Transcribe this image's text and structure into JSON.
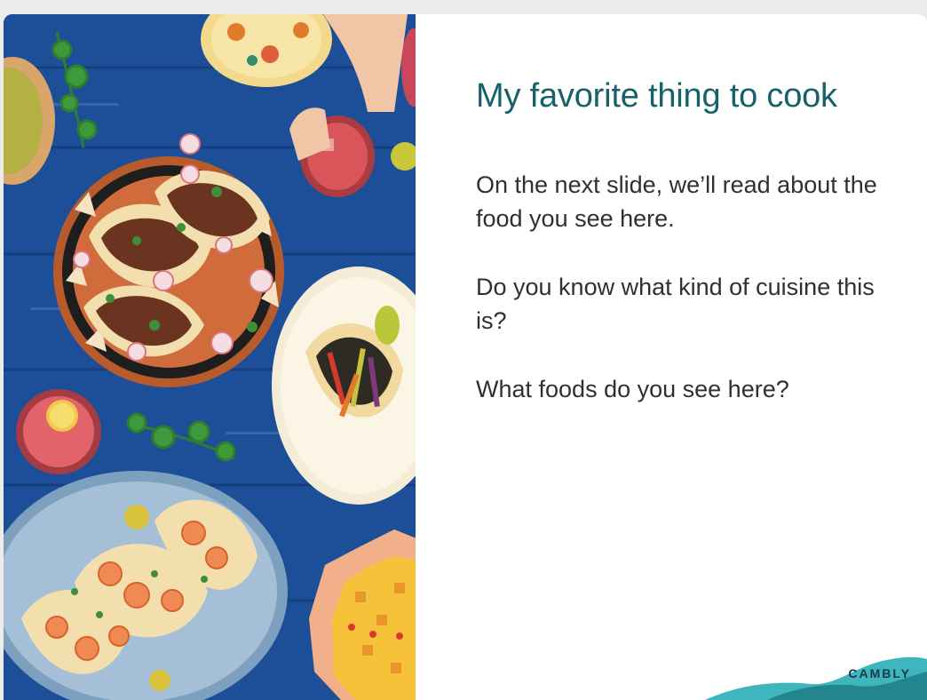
{
  "slide": {
    "title": "My favorite thing to cook",
    "prompts": [
      "On the next slide, we’ll read about the food you see here.",
      "Do you know what kind of cuisine this is?",
      "What foods do you see here?"
    ],
    "brand": "CAMBLY"
  },
  "colors": {
    "title": "#17616b",
    "body_text": "#303030",
    "table_blue": "#1d4f99",
    "brand_teal": "#3fb5bd",
    "brand_dark": "#1f7d86"
  },
  "photo": {
    "subject": "tacos on a blue wooden table"
  }
}
